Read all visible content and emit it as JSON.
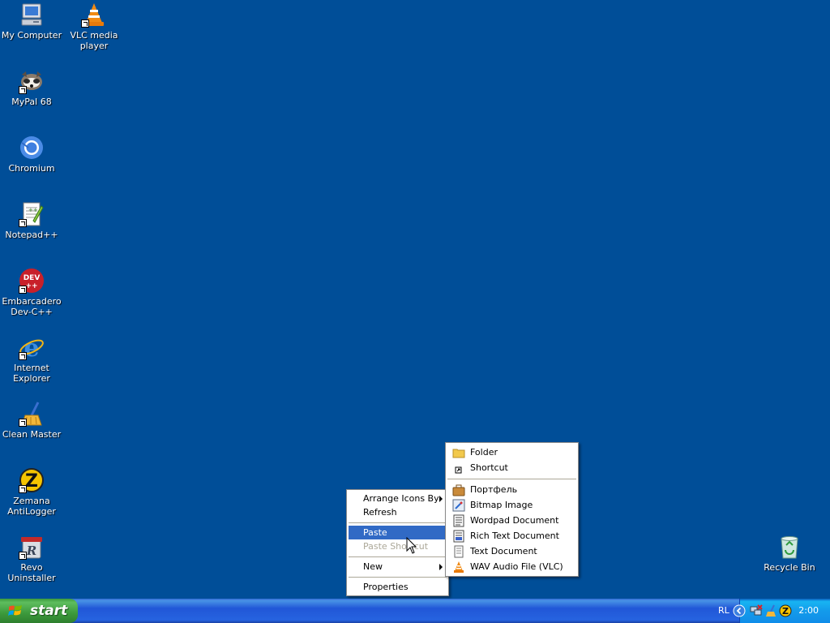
{
  "desktop": {
    "background": "#004e98",
    "icons": [
      {
        "label": "My Computer",
        "icon": "my-computer-icon"
      },
      {
        "label": "VLC media player",
        "icon": "vlc-icon"
      },
      {
        "label": "MyPal 68",
        "icon": "mypal-icon"
      },
      {
        "label": "Chromium",
        "icon": "chromium-icon"
      },
      {
        "label": "Notepad++",
        "icon": "notepad-plus-plus-icon"
      },
      {
        "label": "Embarcadero Dev-C++",
        "icon": "dev-cpp-icon"
      },
      {
        "label": "Internet Explorer",
        "icon": "internet-explorer-icon"
      },
      {
        "label": "Clean Master",
        "icon": "clean-master-icon"
      },
      {
        "label": "Zemana AntiLogger",
        "icon": "zemana-icon"
      },
      {
        "label": "Revo Uninstaller",
        "icon": "revo-uninstaller-icon"
      },
      {
        "label": "Recycle Bin",
        "icon": "recycle-bin-icon"
      }
    ]
  },
  "context_menu": {
    "items": [
      {
        "label": "Arrange Icons By",
        "submenu": true,
        "state": "normal"
      },
      {
        "label": "Refresh",
        "state": "normal"
      },
      {
        "label": "Paste",
        "state": "highlighted"
      },
      {
        "label": "Paste Shortcut",
        "state": "disabled"
      },
      {
        "label": "New",
        "submenu": true,
        "state": "normal"
      },
      {
        "label": "Properties",
        "state": "normal"
      }
    ],
    "highlight_color": "#316ac5"
  },
  "new_submenu": {
    "items": [
      {
        "label": "Folder",
        "icon": "folder-icon"
      },
      {
        "label": "Shortcut",
        "icon": "shortcut-icon"
      },
      {
        "label": "Портфель",
        "icon": "briefcase-icon"
      },
      {
        "label": "Bitmap Image",
        "icon": "bitmap-icon"
      },
      {
        "label": "Wordpad Document",
        "icon": "wordpad-icon"
      },
      {
        "label": "Rich Text Document",
        "icon": "rich-text-icon"
      },
      {
        "label": "Text Document",
        "icon": "text-document-icon"
      },
      {
        "label": "WAV Audio File (VLC)",
        "icon": "vlc-audio-icon"
      }
    ]
  },
  "taskbar": {
    "start_label": "start",
    "language": "RL",
    "clock": "2:00",
    "tray_icons": [
      "show-hidden-icon",
      "network-icon",
      "clean-master-tray-icon",
      "zemana-tray-icon"
    ]
  }
}
